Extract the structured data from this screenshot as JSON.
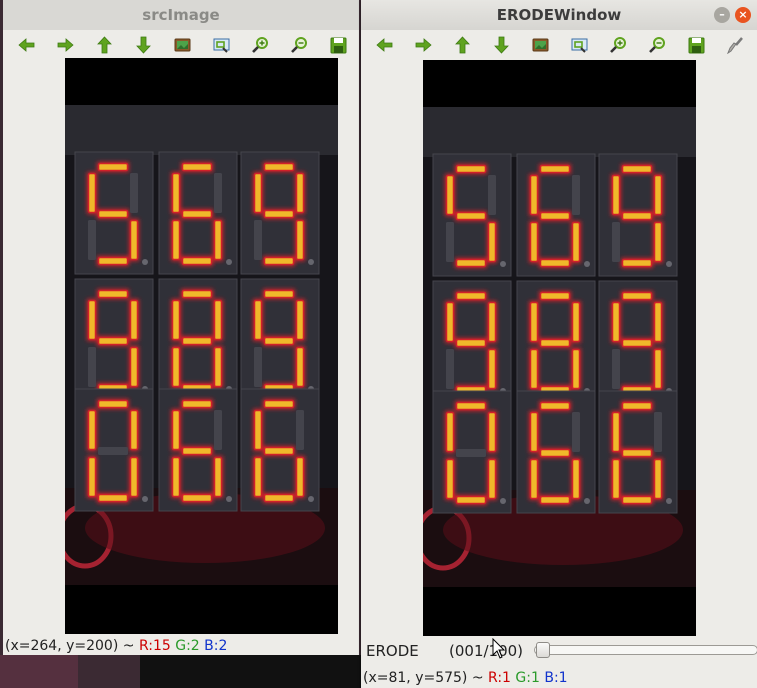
{
  "colors": {
    "accent": "#e95420",
    "toolbar_icon": "#5fa31f",
    "segment_lit": "#f0b82a",
    "segment_glow": "#d0202a"
  },
  "src_window": {
    "title": "srcImage",
    "toolbar": [
      "arrow-left-icon",
      "arrow-right-icon",
      "arrow-up-icon",
      "arrow-down-icon",
      "image-icon",
      "zoom-area-icon",
      "zoom-in-icon",
      "zoom-out-icon",
      "save-icon"
    ],
    "status": {
      "coords": "(x=264, y=200) ~ ",
      "r": "R:15",
      "g": "G:2",
      "b": "B:2"
    }
  },
  "erode_window": {
    "title": "ERODEWindow",
    "toolbar": [
      "arrow-left-icon",
      "arrow-right-icon",
      "arrow-up-icon",
      "arrow-down-icon",
      "image-icon",
      "zoom-area-icon",
      "zoom-in-icon",
      "zoom-out-icon",
      "save-icon",
      "brush-icon"
    ],
    "trackbar": {
      "label": "ERODE",
      "value": "(001/100)",
      "level": 0.01
    },
    "status": {
      "coords": "(x=81, y=575) ~ ",
      "r": "R:1",
      "g": "G:1",
      "b": "B:1"
    },
    "buttons": {
      "minimize": "–",
      "close": "×"
    }
  },
  "display_digits": [
    [
      "5",
      "6",
      "9"
    ],
    [
      "9",
      "8",
      "9"
    ],
    [
      "0",
      "6",
      "6"
    ]
  ]
}
